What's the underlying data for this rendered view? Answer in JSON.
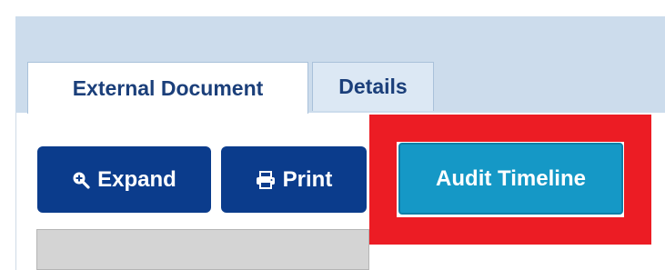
{
  "tabs": [
    {
      "label": "External Document",
      "active": true
    },
    {
      "label": "Details",
      "active": false
    }
  ],
  "toolbar": {
    "expand_label": "Expand",
    "expand_icon": "zoom-in-icon",
    "print_label": "Print",
    "print_icon": "printer-icon",
    "audit_timeline_label": "Audit Timeline"
  },
  "colors": {
    "header_band": "#ccdcec",
    "primary_button": "#0b3c8c",
    "audit_button": "#1598c6",
    "highlight_box": "#ec1c24",
    "tab_text": "#1b3f7a"
  }
}
